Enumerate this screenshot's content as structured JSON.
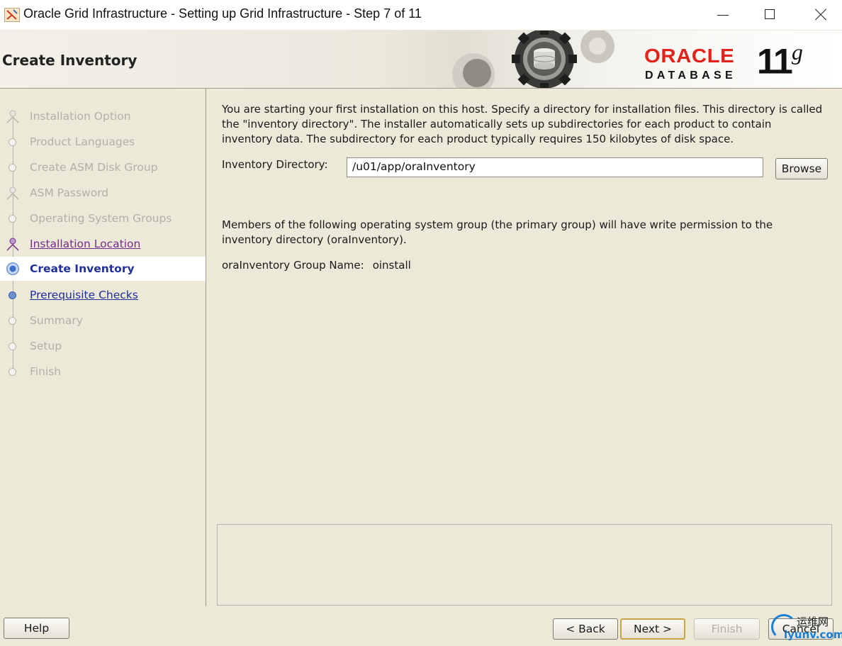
{
  "window": {
    "title": "Oracle Grid Infrastructure - Setting up Grid Infrastructure - Step 7 of 11"
  },
  "header": {
    "page_title": "Create Inventory",
    "logo_word": "ORACLE",
    "logo_trademark": "®",
    "logo_sub": "DATABASE",
    "version_number": "11",
    "version_letter": "g"
  },
  "nav": {
    "steps": [
      {
        "label": "Installation Option",
        "state": "disabled"
      },
      {
        "label": "Product Languages",
        "state": "disabled"
      },
      {
        "label": "Create ASM Disk Group",
        "state": "disabled"
      },
      {
        "label": "ASM Password",
        "state": "disabled"
      },
      {
        "label": "Operating System Groups",
        "state": "disabled"
      },
      {
        "label": "Installation Location",
        "state": "visited"
      },
      {
        "label": "Create Inventory",
        "state": "current"
      },
      {
        "label": "Prerequisite Checks",
        "state": "link"
      },
      {
        "label": "Summary",
        "state": "disabled"
      },
      {
        "label": "Setup",
        "state": "disabled"
      },
      {
        "label": "Finish",
        "state": "disabled"
      }
    ]
  },
  "content": {
    "intro": "You are starting your first installation on this host. Specify a directory for installation files. This directory is called the \"inventory directory\". The installer automatically sets up subdirectories for each product to contain inventory data. The subdirectory for each product typically requires 150 kilobytes of disk space.",
    "inventory_label": "Inventory Directory:",
    "inventory_value": "/u01/app/oraInventory",
    "browse_label": "Browse",
    "members_text": "Members of the following operating system group (the primary group) will have write permission to the inventory directory (oraInventory).",
    "group_label": "oraInventory Group Name:",
    "group_value": "oinstall"
  },
  "buttons": {
    "help": "Help",
    "back": "< Back",
    "next": "Next >",
    "finish": "Finish",
    "cancel": "Cancel"
  },
  "watermark": {
    "cn": "运维网",
    "en": "iyunv.com"
  },
  "colors": {
    "oracle_red": "#e2231a",
    "link_blue": "#1f2f9c",
    "visited_purple": "#7a2a8c",
    "disabled_gray": "#b2b0a8",
    "panel_bg": "#ece9d8"
  }
}
